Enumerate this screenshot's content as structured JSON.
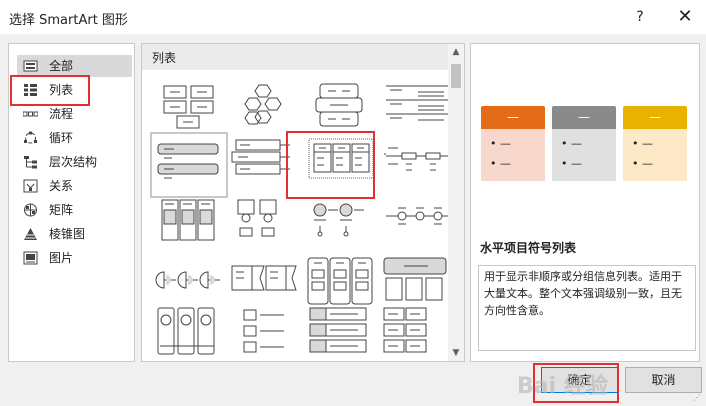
{
  "window": {
    "title": "选择 SmartArt 图形",
    "help_label": "?",
    "close_label": "✕"
  },
  "categories": [
    {
      "label": "全部",
      "icon": "all-icon"
    },
    {
      "label": "列表",
      "icon": "list-icon"
    },
    {
      "label": "流程",
      "icon": "process-icon"
    },
    {
      "label": "循环",
      "icon": "cycle-icon"
    },
    {
      "label": "层次结构",
      "icon": "hierarchy-icon"
    },
    {
      "label": "关系",
      "icon": "relationship-icon"
    },
    {
      "label": "矩阵",
      "icon": "matrix-icon"
    },
    {
      "label": "棱锥图",
      "icon": "pyramid-icon"
    },
    {
      "label": "图片",
      "icon": "picture-icon"
    }
  ],
  "gallery": {
    "header": "列表"
  },
  "preview": {
    "cards": [
      {
        "head": "—",
        "bullet1": "• —",
        "bullet2": "• —",
        "head_color": "#e46c19",
        "body_color": "#f8d7cc"
      },
      {
        "head": "—",
        "bullet1": "• —",
        "bullet2": "• —",
        "head_color": "#8a8a8a",
        "body_color": "#e0e0e0"
      },
      {
        "head": "—",
        "bullet1": "• —",
        "bullet2": "• —",
        "head_color": "#e8b300",
        "body_color": "#fde8c8"
      }
    ],
    "layout_name": "水平项目符号列表",
    "description": "用于显示非顺序或分组信息列表。适用于大量文本。整个文本强调级别一致，且无方向性含意。"
  },
  "buttons": {
    "ok": "确定",
    "cancel": "取消"
  },
  "watermark": "Bai 经验",
  "highlight_color": "#e03030"
}
